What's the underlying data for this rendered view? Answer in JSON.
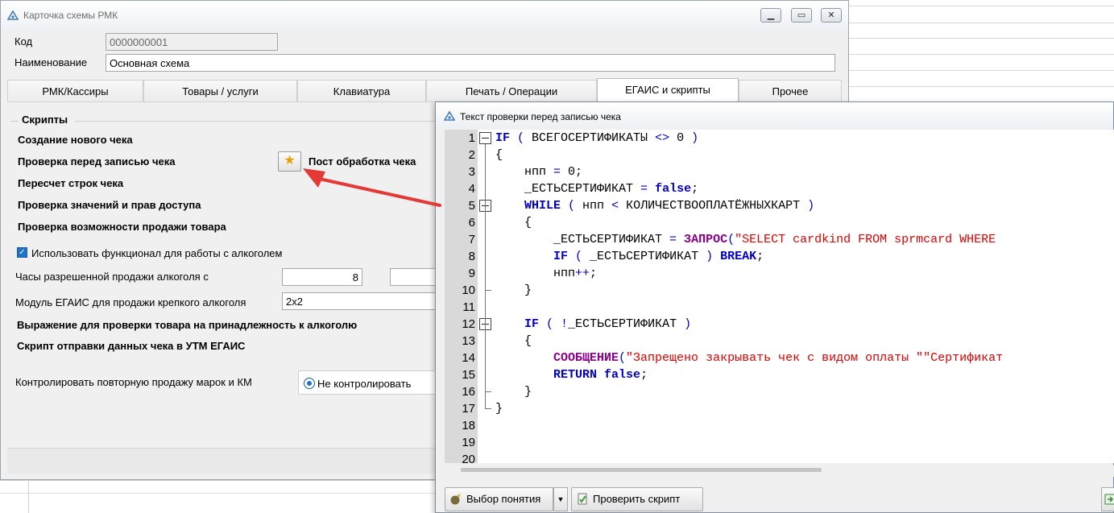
{
  "main_window": {
    "title": "Карточка схемы РМК",
    "fields": {
      "code_label": "Код",
      "code_value": "0000000001",
      "name_label": "Наименование",
      "name_value": "Основная схема"
    },
    "tabs": [
      {
        "label": "РМК/Кассиры"
      },
      {
        "label": "Товары / услуги"
      },
      {
        "label": "Клавиатура"
      },
      {
        "label": "Печать / Операции"
      },
      {
        "label": "ЕГАИС и скрипты"
      },
      {
        "label": "Прочее"
      }
    ],
    "scripts": {
      "group_title": "Скрипты",
      "items": [
        "Создание нового чека",
        "Проверка перед записью чека",
        "Пересчет строк чека",
        "Проверка значений и прав доступа",
        "Проверка возможности продажи товара"
      ],
      "post_processing": "Пост обработка чека"
    },
    "alcohol": {
      "use_alcohol_label": "Использовать функционал для работы с алкоголем",
      "use_alcohol_checked": true,
      "hours_label": "Часы разрешенной продажи алкоголя с",
      "hours_from": "8",
      "egais_module_label": "Модуль ЕГАИС для продажи крепкого алкоголя",
      "egais_module_value": "2x2",
      "expression_label": "Выражение для проверки товара на принадлежность к алкоголю",
      "utm_script_label": "Скрипт отправки данных чека в УТМ ЕГАИС",
      "control_label": "Контролировать повторную продажу марок и КМ",
      "control_option": "Не контролировать"
    }
  },
  "editor_window": {
    "title": "Текст проверки перед записью чека",
    "lines": [
      {
        "n": "1",
        "tokens": [
          [
            "kw",
            "IF"
          ],
          [
            "op",
            " ( "
          ],
          [
            "plain",
            "ВСЕГОСЕРТИФИКАТЫ "
          ],
          [
            "op",
            "<>"
          ],
          [
            "plain",
            " 0 "
          ],
          [
            "op",
            ")"
          ]
        ]
      },
      {
        "n": "2",
        "tokens": [
          [
            "plain",
            "{"
          ]
        ]
      },
      {
        "n": "3",
        "tokens": [
          [
            "plain",
            "    нпп "
          ],
          [
            "op",
            "="
          ],
          [
            "plain",
            " 0;"
          ]
        ]
      },
      {
        "n": "4",
        "tokens": [
          [
            "plain",
            "    _ЕСТЬСЕРТИФИКАТ "
          ],
          [
            "op",
            "="
          ],
          [
            "plain",
            " "
          ],
          [
            "kw",
            "false"
          ],
          [
            "plain",
            ";"
          ]
        ]
      },
      {
        "n": "5",
        "tokens": [
          [
            "plain",
            "    "
          ],
          [
            "kw",
            "WHILE"
          ],
          [
            "op",
            " ( "
          ],
          [
            "plain",
            "нпп "
          ],
          [
            "op",
            "<"
          ],
          [
            "plain",
            " КОЛИЧЕСТВООПЛАТЁЖНЫХКАРТ "
          ],
          [
            "op",
            ")"
          ]
        ]
      },
      {
        "n": "6",
        "tokens": [
          [
            "plain",
            "    {"
          ]
        ]
      },
      {
        "n": "7",
        "tokens": [
          [
            "plain",
            "        _ЕСТЬСЕРТИФИКАТ "
          ],
          [
            "op",
            "="
          ],
          [
            "plain",
            " "
          ],
          [
            "fn",
            "ЗАПРОС"
          ],
          [
            "op",
            "("
          ],
          [
            "str",
            "\"SELECT cardkind FROM sprmcard WHERE"
          ]
        ]
      },
      {
        "n": "8",
        "tokens": [
          [
            "plain",
            "        "
          ],
          [
            "kw",
            "IF"
          ],
          [
            "op",
            " ( "
          ],
          [
            "plain",
            "_ЕСТЬСЕРТИФИКАТ "
          ],
          [
            "op",
            ")"
          ],
          [
            "plain",
            " "
          ],
          [
            "kw",
            "BREAK"
          ],
          [
            "plain",
            ";"
          ]
        ]
      },
      {
        "n": "9",
        "tokens": [
          [
            "plain",
            "        нпп"
          ],
          [
            "op",
            "++"
          ],
          [
            "plain",
            ";"
          ]
        ]
      },
      {
        "n": "10",
        "tokens": [
          [
            "plain",
            "    }"
          ]
        ]
      },
      {
        "n": "11",
        "tokens": []
      },
      {
        "n": "12",
        "tokens": [
          [
            "plain",
            "    "
          ],
          [
            "kw",
            "IF"
          ],
          [
            "op",
            " ( !"
          ],
          [
            "plain",
            "_ЕСТЬСЕРТИФИКАТ "
          ],
          [
            "op",
            ")"
          ]
        ]
      },
      {
        "n": "13",
        "tokens": [
          [
            "plain",
            "    {"
          ]
        ]
      },
      {
        "n": "14",
        "tokens": [
          [
            "plain",
            "        "
          ],
          [
            "fn",
            "СООБЩЕНИЕ"
          ],
          [
            "op",
            "("
          ],
          [
            "str",
            "\"Запрещено закрывать чек с видом оплаты \"\"Сертификат"
          ]
        ]
      },
      {
        "n": "15",
        "tokens": [
          [
            "plain",
            "        "
          ],
          [
            "kw",
            "RETURN"
          ],
          [
            "plain",
            " "
          ],
          [
            "kw",
            "false"
          ],
          [
            "plain",
            ";"
          ]
        ]
      },
      {
        "n": "16",
        "tokens": [
          [
            "plain",
            "    }"
          ]
        ]
      },
      {
        "n": "17",
        "tokens": [
          [
            "plain",
            "}"
          ]
        ]
      },
      {
        "n": "18",
        "tokens": []
      },
      {
        "n": "19",
        "tokens": []
      },
      {
        "n": "20",
        "tokens": []
      }
    ],
    "buttons": {
      "concept_select": "Выбор понятия",
      "check_script": "Проверить скрипт"
    }
  },
  "colors": {
    "accent": "#1e73c8",
    "keyword": "#0000c8",
    "function": "#8b008b",
    "string": "#e00000",
    "arrow": "#e53935"
  }
}
